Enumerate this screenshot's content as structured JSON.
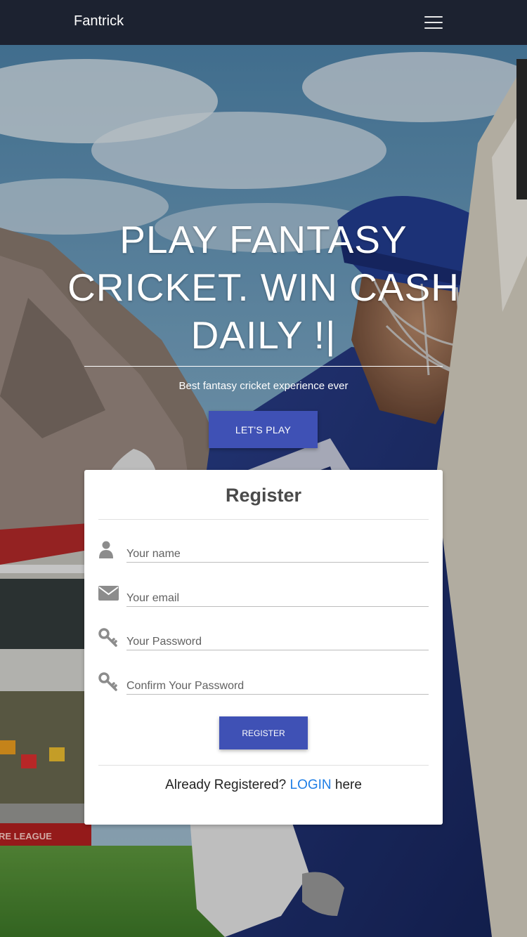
{
  "nav": {
    "brand": "Fantrick",
    "menu_icon": "hamburger-menu-icon"
  },
  "hero": {
    "headline": "PLAY FANTASY CRICKET. WIN CASH DAILY !|",
    "subline": "Best fantasy cricket experience ever",
    "cta_label": "LET'S PLAY",
    "banner_text": "RE LEAGUE"
  },
  "register": {
    "title": "Register",
    "fields": [
      {
        "placeholder": "Your name",
        "icon": "user-icon"
      },
      {
        "placeholder": "Your email",
        "icon": "envelope-icon"
      },
      {
        "placeholder": "Your Password",
        "icon": "key-icon"
      },
      {
        "placeholder": "Confirm Your Password",
        "icon": "key-icon"
      }
    ],
    "submit_label": "REGISTER",
    "login_prefix": "Already Registered? ",
    "login_link": "LOGIN",
    "login_suffix": " here"
  },
  "colors": {
    "navbar": "#1c2230",
    "primary": "#3f51b5",
    "link": "#1e7ee6"
  }
}
